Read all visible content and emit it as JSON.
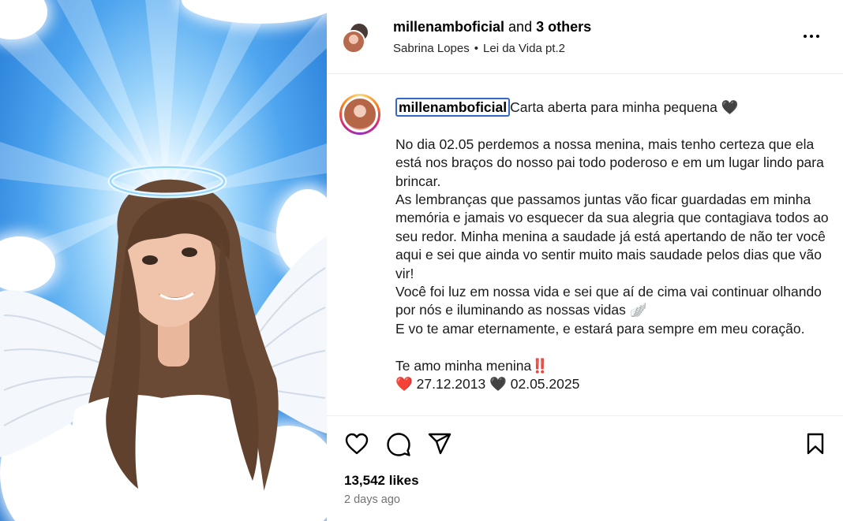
{
  "post": {
    "header": {
      "username": "millenamboficial",
      "and_text": " and ",
      "others": "3 others",
      "artist": "Sabrina Lopes",
      "separator": "•",
      "song": "Lei da Vida pt.2"
    },
    "caption": {
      "username": "millenamboficial",
      "title": "Carta aberta para minha pequena 🖤",
      "paragraph1": "No dia 02.05 perdemos a nossa menina, mais tenho certeza que ela está nos braços do nosso pai todo poderoso e em um lugar lindo para brincar.",
      "paragraph2": "As lembranças que passamos juntas vão ficar guardadas em minha memória e jamais vo esquecer da sua alegria que contagiava todos ao seu redor. Minha menina a saudade já está apertando de não ter você aqui e sei que ainda vo sentir muito mais saudade pelos dias que vão vir!",
      "paragraph3": "Você foi luz em nossa vida e sei que aí de cima vai continuar olhando por nós e iluminando as nossas vidas 🪽",
      "paragraph4": "E vo te amar eternamente, e estará para sempre em meu coração.",
      "closing": "Te amo minha menina‼️",
      "dates": "❤️ 27.12.2013 🖤 02.05.2025"
    },
    "likes": "13,542 likes",
    "time": "2 days ago"
  },
  "icons": {
    "more": "more-options-icon",
    "like": "heart-icon",
    "comment": "comment-icon",
    "share": "paper-plane-icon",
    "save": "bookmark-icon"
  },
  "colors": {
    "link_border": "#3568c9",
    "muted": "#737373",
    "sky": "#2f86dd"
  }
}
